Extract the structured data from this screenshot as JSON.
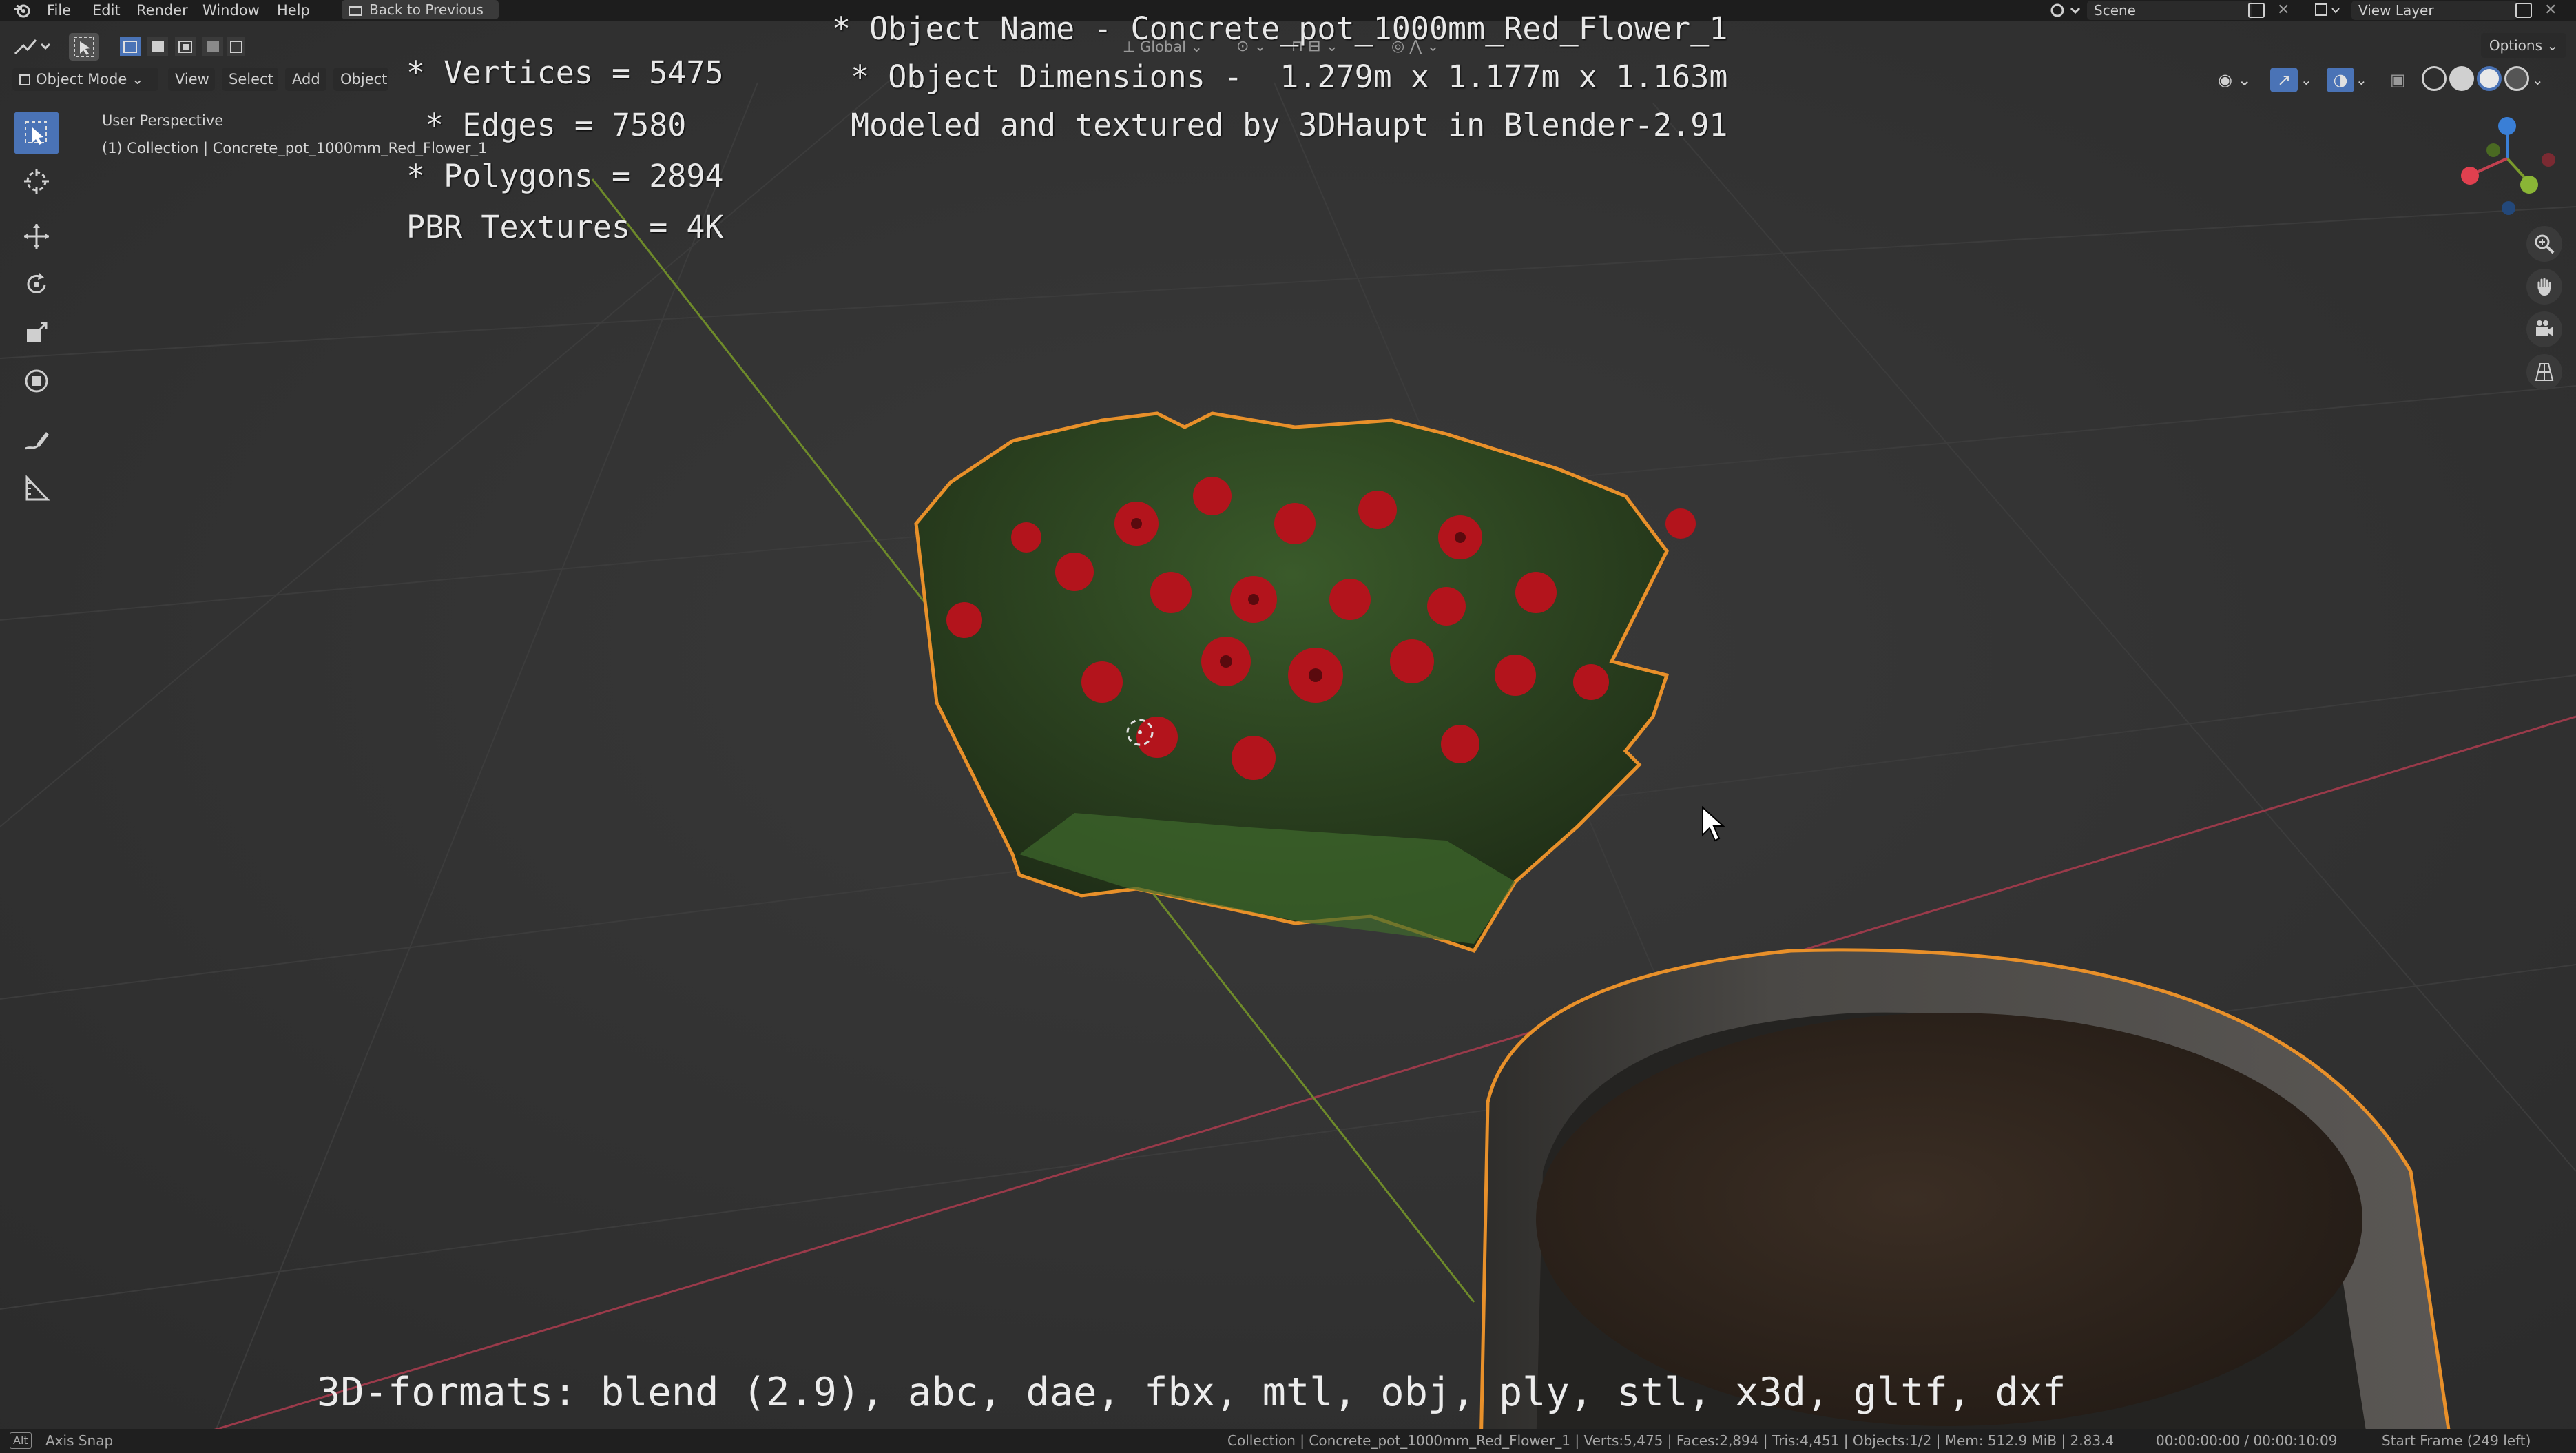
{
  "app": {
    "name": "Blender",
    "version": "2.83.4"
  },
  "menu": {
    "items": [
      "File",
      "Edit",
      "Render",
      "Window",
      "Help"
    ],
    "back_button": "Back to Previous",
    "scene_label": "Scene",
    "view_layer_label": "View Layer"
  },
  "header": {
    "mode": "Object Mode",
    "menus": [
      "View",
      "Select",
      "Add",
      "Object"
    ],
    "transform_orientation": "Global",
    "options_label": "Options"
  },
  "viewport": {
    "perspective_label": "User Perspective",
    "collection_label": "(1) Collection | Concrete_pot_1000mm_Red_Flower_1",
    "info_left": [
      "* Vertices = 5475",
      " * Edges = 7580",
      "* Polygons = 2894",
      "PBR Textures = 4K"
    ],
    "info_center": [
      "* Object Name - Concrete_pot_1000mm_Red_Flower_1",
      " * Object Dimensions -  1.279m x 1.177m x 1.163m",
      " Modeled and textured by 3DHaupt in Blender-2.91"
    ],
    "formats_text": "3D-formats: blend (2.9), abc, dae, fbx, mtl, obj, ply, stl, x3d, gltf, dxf"
  },
  "status_bar": {
    "key": "Alt",
    "hint": "Axis Snap",
    "stats": "Collection | Concrete_pot_1000mm_Red_Flower_1 | Verts:5,475 | Faces:2,894 | Tris:4,451 | Objects:1/2 | Mem: 512.9 MiB | 2.83.4",
    "time": "00:00:00:00 / 00:00:10:09",
    "frame": "Start Frame (249 left)"
  },
  "colors": {
    "background": "#303030",
    "selection_outline": "#e8902a",
    "active_tool": "#4a73b6",
    "x_axis": "#c2404f",
    "y_axis": "#7a9a2c",
    "z_axis": "#3a7fd6"
  }
}
